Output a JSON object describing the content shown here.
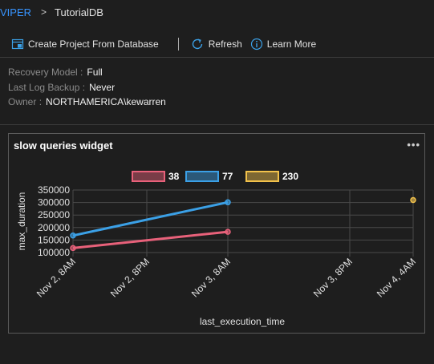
{
  "breadcrumb": {
    "root": "VIPER",
    "separator": ">",
    "current": "TutorialDB"
  },
  "toolbar": {
    "create_project": "Create Project From Database",
    "refresh": "Refresh",
    "learn_more": "Learn More"
  },
  "properties": [
    {
      "key": "Recovery Model",
      "sep": ":",
      "value": "Full"
    },
    {
      "key": "Last Log Backup",
      "sep": ":",
      "value": "Never"
    },
    {
      "key": "Owner",
      "sep": ":",
      "value": "NORTHAMERICA\\kewarren"
    }
  ],
  "widget": {
    "title": "slow queries widget",
    "menu": "•••"
  },
  "colors": {
    "accent": "#3794ff",
    "series_38": "#e8617a",
    "series_77": "#3ba0e6",
    "series_230": "#f2c24b"
  },
  "chart_data": {
    "type": "line",
    "title": "",
    "xlabel": "last_execution_time",
    "ylabel": "max_duration",
    "x_ticks": [
      "Nov 2, 8AM",
      "Nov 2, 8PM",
      "Nov 3, 8AM",
      "Nov 3, 8PM",
      "Nov 4, 4AM"
    ],
    "y_ticks": [
      "100000",
      "150000",
      "200000",
      "250000",
      "300000",
      "350000"
    ],
    "ylim": [
      100000,
      350000
    ],
    "legend_position": "top",
    "grid": true,
    "series": [
      {
        "name": "38",
        "color": "#e8617a",
        "points": [
          {
            "x": "2019-11-02T08:00",
            "y": 118000
          },
          {
            "x": "2019-11-03T08:00",
            "y": 183000
          }
        ]
      },
      {
        "name": "77",
        "color": "#3ba0e6",
        "points": [
          {
            "x": "2019-11-02T08:00",
            "y": 168000
          },
          {
            "x": "2019-11-03T08:00",
            "y": 301000
          }
        ]
      },
      {
        "name": "230",
        "color": "#f2c24b",
        "points": [
          {
            "x": "2019-11-04T04:00",
            "y": 310000
          }
        ]
      }
    ]
  }
}
